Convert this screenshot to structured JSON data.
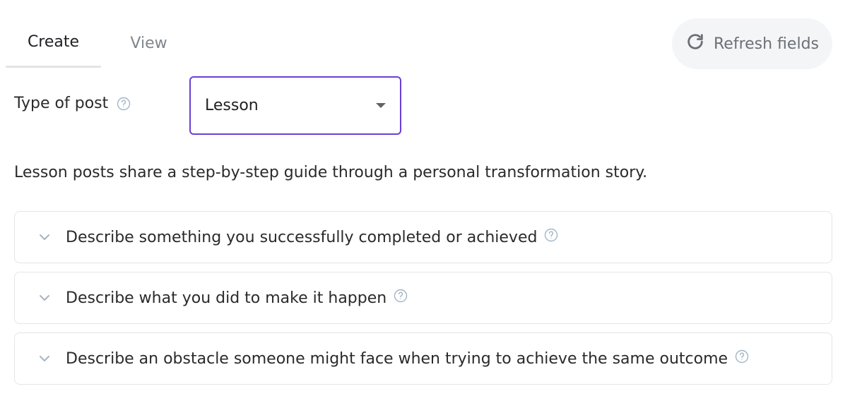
{
  "tabs": [
    {
      "label": "Create",
      "active": true
    },
    {
      "label": "View",
      "active": false
    }
  ],
  "refresh": {
    "label": "Refresh fields",
    "icon": "refresh-icon"
  },
  "type_of_post": {
    "label": "Type of post",
    "selected": "Lesson",
    "help_icon": "question-circle-icon"
  },
  "description": "Lesson posts share a step-by-step guide through a personal transformation story.",
  "sections": [
    {
      "title": "Describe something you successfully completed or achieved",
      "expanded": false
    },
    {
      "title": "Describe what you did to make it happen",
      "expanded": false
    },
    {
      "title": "Describe an obstacle someone might face when trying to achieve the same outcome",
      "expanded": false
    }
  ],
  "colors": {
    "accent": "#6a3fd6",
    "muted_text": "#80868b",
    "help_icon": "#a3b5c6",
    "border": "#e3e5e8"
  }
}
